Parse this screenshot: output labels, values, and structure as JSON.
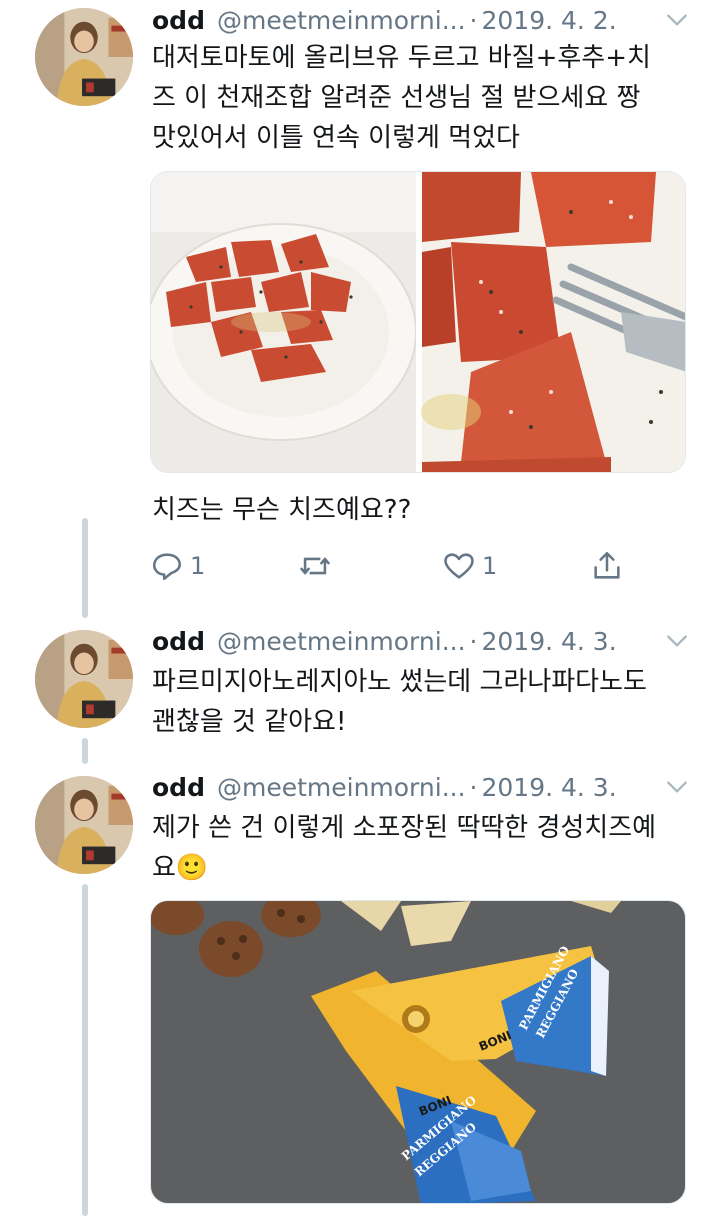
{
  "tweets": [
    {
      "name": "odd",
      "handle": "@meetmeinmorni...",
      "separator": "·",
      "date": "2019. 4. 2.",
      "text": "대저토마토에 올리브유 두르고 바질+후추+치\n즈 이 천재조합 알려준 선생님 절 받으세요 짱\n맛있어서 이틀 연속 이렇게 먹었다"
    },
    {
      "name": "odd",
      "handle": "@meetmeinmorni...",
      "separator": "·",
      "date": "2019. 4. 3.",
      "text": "파르미지아노레지아노 썼는데 그라나파다노도\n괜찮을 것 같아요!"
    },
    {
      "name": "odd",
      "handle": "@meetmeinmorni...",
      "separator": "·",
      "date": "2019. 4. 3.",
      "text": "제가 쓴 건 이렇게 소포장된 딱딱한 경성치즈예\n요",
      "emoji": "🙂"
    }
  ],
  "reply": {
    "text": "치즈는 무슨 치즈예요??",
    "reply_count": "1",
    "like_count": "1"
  },
  "product_labels": {
    "brand": "BONI",
    "line1": "PARMIGIANO",
    "line2": "REGGIANO"
  },
  "icons": {
    "reply": "reply-icon",
    "retweet": "retweet-icon",
    "like": "heart-icon",
    "share": "share-icon",
    "menu": "chevron-down-icon"
  },
  "colors": {
    "text": "#14171a",
    "muted": "#657786",
    "thread_line": "#ccd6dd"
  }
}
